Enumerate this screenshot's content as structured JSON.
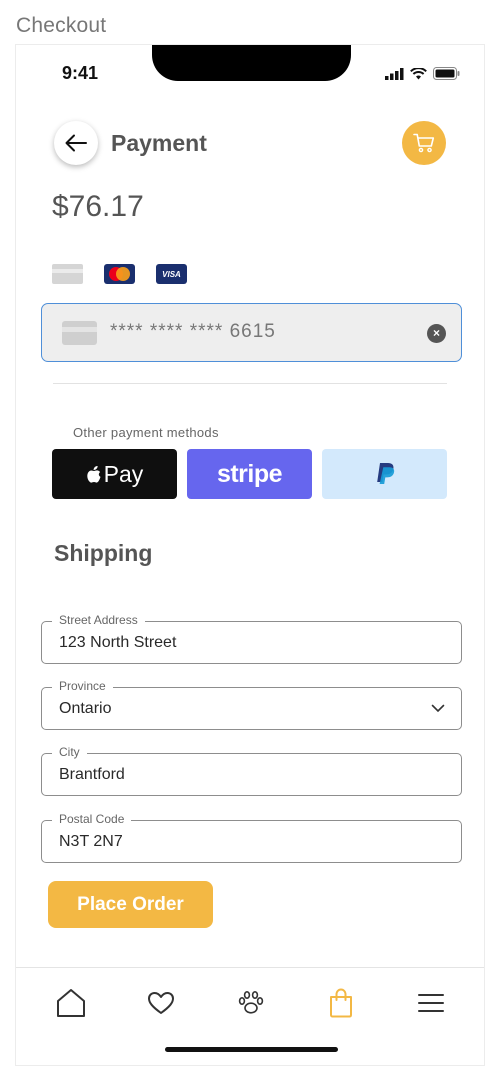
{
  "frame_label": "Checkout",
  "status_bar": {
    "time": "9:41"
  },
  "header": {
    "title": "Payment",
    "back_icon": "arrow-left-icon",
    "cart_icon": "shopping-cart-icon"
  },
  "payment": {
    "amount": "$76.17",
    "card_types": [
      "generic-card-icon",
      "mastercard-icon",
      "visa-icon"
    ],
    "visa_text": "VISA",
    "card_number": "**** **** **** 6615",
    "clear_glyph": "×"
  },
  "other_methods": {
    "label": "Other payment methods",
    "apple_pay": "Pay",
    "stripe": "stripe"
  },
  "shipping": {
    "title": "Shipping",
    "fields": [
      {
        "label": "Street Address",
        "value": "123 North Street"
      },
      {
        "label": "Province",
        "value": "Ontario"
      },
      {
        "label": "City",
        "value": "Brantford"
      },
      {
        "label": "Postal Code",
        "value": "N3T 2N7"
      }
    ]
  },
  "place_order": "Place Order",
  "tabbar": {
    "items": [
      "home-icon",
      "heart-icon",
      "paw-icon",
      "shopping-bag-icon",
      "menu-icon"
    ],
    "active": "shopping-bag-icon"
  },
  "colors": {
    "accent": "#f3b844",
    "focus_border": "#4f8fd8",
    "stripe": "#6666ee",
    "paypal_bg": "#d3e9fc",
    "apple_bg": "#0f0f0f"
  }
}
